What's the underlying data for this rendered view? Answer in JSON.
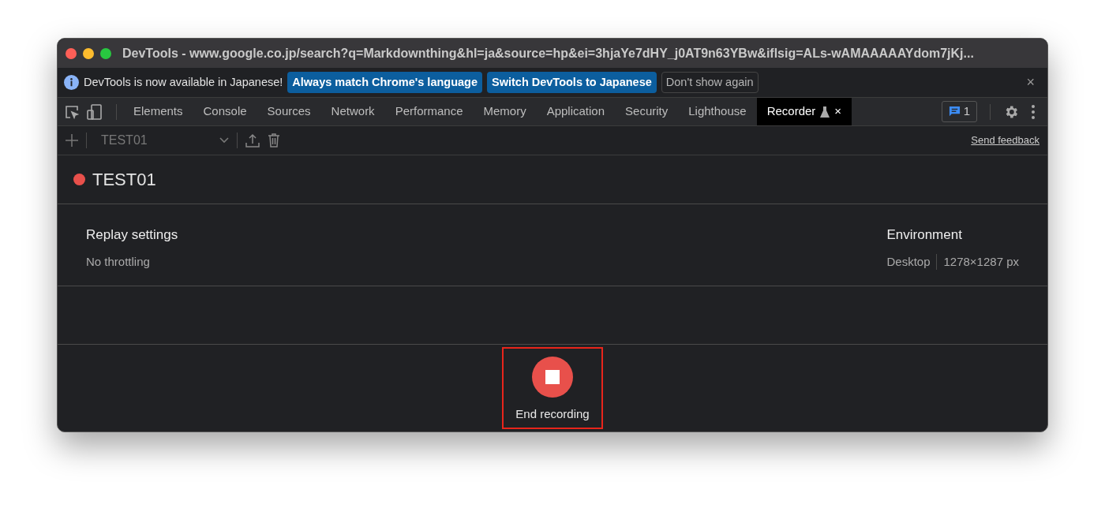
{
  "window": {
    "title": "DevTools - www.google.co.jp/search?q=Markdownthing&hl=ja&source=hp&ei=3hjaYe7dHY_j0AT9n63YBw&iflsig=ALs-wAMAAAAAYdom7jKj..."
  },
  "infobar": {
    "message": "DevTools is now available in Japanese!",
    "buttons": [
      {
        "label": "Always match Chrome's language",
        "kind": "primary"
      },
      {
        "label": "Switch DevTools to Japanese",
        "kind": "primary"
      },
      {
        "label": "Don't show again",
        "kind": "secondary"
      }
    ],
    "close": "×"
  },
  "tabs": [
    {
      "label": "Elements",
      "selected": false
    },
    {
      "label": "Console",
      "selected": false
    },
    {
      "label": "Sources",
      "selected": false
    },
    {
      "label": "Network",
      "selected": false
    },
    {
      "label": "Performance",
      "selected": false
    },
    {
      "label": "Memory",
      "selected": false
    },
    {
      "label": "Application",
      "selected": false
    },
    {
      "label": "Security",
      "selected": false
    },
    {
      "label": "Lighthouse",
      "selected": false
    },
    {
      "label": "Recorder",
      "selected": true,
      "experimental": true,
      "close": "×"
    }
  ],
  "issues_badge": "1",
  "toolbar": {
    "recording_select": "TEST01",
    "send_feedback": "Send feedback"
  },
  "recording": {
    "title": "TEST01",
    "recording": true
  },
  "settings": {
    "replay": {
      "title": "Replay settings",
      "value": "No throttling"
    },
    "environment": {
      "title": "Environment",
      "device": "Desktop",
      "size": "1278×1287 px"
    }
  },
  "footer": {
    "button": "End recording",
    "highlighted": true
  }
}
